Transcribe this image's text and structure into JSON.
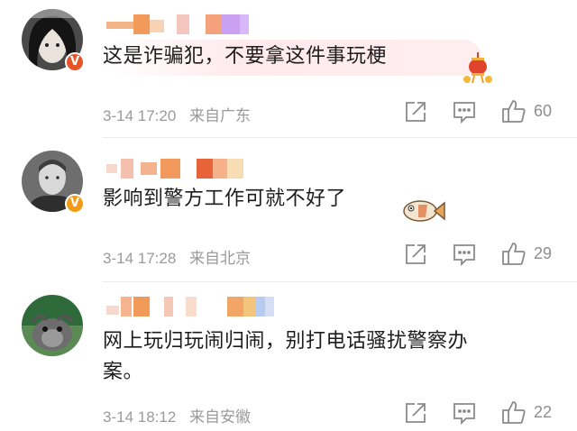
{
  "comments": [
    {
      "text": "这是诈骗犯，不要拿这件事玩梗",
      "date": "3-14",
      "time": "17:20",
      "location": "来自广东",
      "likes": "60",
      "badge": "V"
    },
    {
      "text": "影响到警方工作可就不好了",
      "date": "3-14",
      "time": "17:28",
      "location": "来自北京",
      "likes": "29",
      "badge": "V"
    },
    {
      "text": "网上玩归玩闹归闹，别打电话骚扰警察办\n案。",
      "date": "3-14",
      "time": "18:12",
      "location": "来自安徽",
      "likes": "22"
    }
  ],
  "icons": {
    "share": "share-icon",
    "reply": "comment-icon",
    "like": "thumbs-up-icon"
  },
  "colors": {
    "meta": "#9a9a9a",
    "badge_orange": "#f39a16",
    "badge_red": "#e8542a"
  }
}
